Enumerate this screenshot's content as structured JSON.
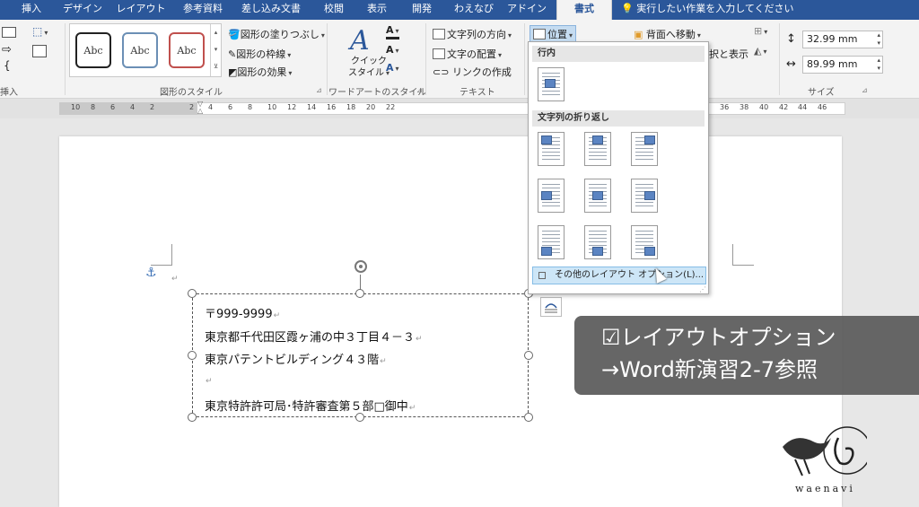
{
  "menu_tabs": [
    "挿入",
    "デザイン",
    "レイアウト",
    "参考資料",
    "差し込み文書",
    "校閲",
    "表示",
    "開発",
    "わえなび",
    "アドイン",
    "書式"
  ],
  "active_tab": "書式",
  "tell_me": "実行したい作業を入力してください",
  "ribbon": {
    "insert_group_label": "挿入",
    "shape_styles": {
      "label": "図形のスタイル",
      "samples": [
        "Abc",
        "Abc",
        "Abc"
      ],
      "fill": "図形の塗りつぶし",
      "outline": "図形の枠線",
      "effects": "図形の効果",
      "colors": [
        "#222222",
        "#6b8fb5",
        "#c0504d"
      ]
    },
    "wordart": {
      "label": "ワードアートのスタイル",
      "quick_styles": "クイックスタイル",
      "quick_styles_line1": "クイック",
      "quick_styles_line2": "スタイル",
      "text_fill_glyph": "A",
      "text_outline_glyph": "A",
      "text_effects_glyph": "A"
    },
    "text": {
      "label": "テキスト",
      "direction": "文字列の方向",
      "align": "文字の配置",
      "link": "リンクの作成"
    },
    "arrange": {
      "position": "位置",
      "send_back": "背面へ移動",
      "selection_pane": "択と表示"
    },
    "size": {
      "label": "サイズ",
      "height": "32.99 mm",
      "width": "89.99 mm"
    }
  },
  "ruler_labels": [
    "10",
    "8",
    "6",
    "4",
    "2",
    "",
    "2",
    "4",
    "6",
    "8",
    "10",
    "12",
    "14",
    "16",
    "18",
    "20",
    "22",
    "",
    "",
    "",
    "",
    "",
    "",
    "",
    "",
    "",
    "",
    "",
    "",
    "",
    "",
    "",
    "",
    "36",
    "38",
    "40",
    "42",
    "44",
    "46"
  ],
  "position_menu": {
    "inline_header": "行内",
    "wrap_header": "文字列の折り返し",
    "more_options": "その他のレイアウト オプション(L)..."
  },
  "document": {
    "lines": [
      "〒999-9999",
      "東京都千代田区霞ヶ浦の中３丁目４－３",
      "東京パテントビルディング４３階",
      "",
      "東京特許許可局･特許審査第５部□御中"
    ],
    "paragraph_mark": "↵"
  },
  "caption": {
    "line1": "☑レイアウトオプション",
    "line2": "→Word新演習2-7参照"
  },
  "logo_text": "waenavi"
}
